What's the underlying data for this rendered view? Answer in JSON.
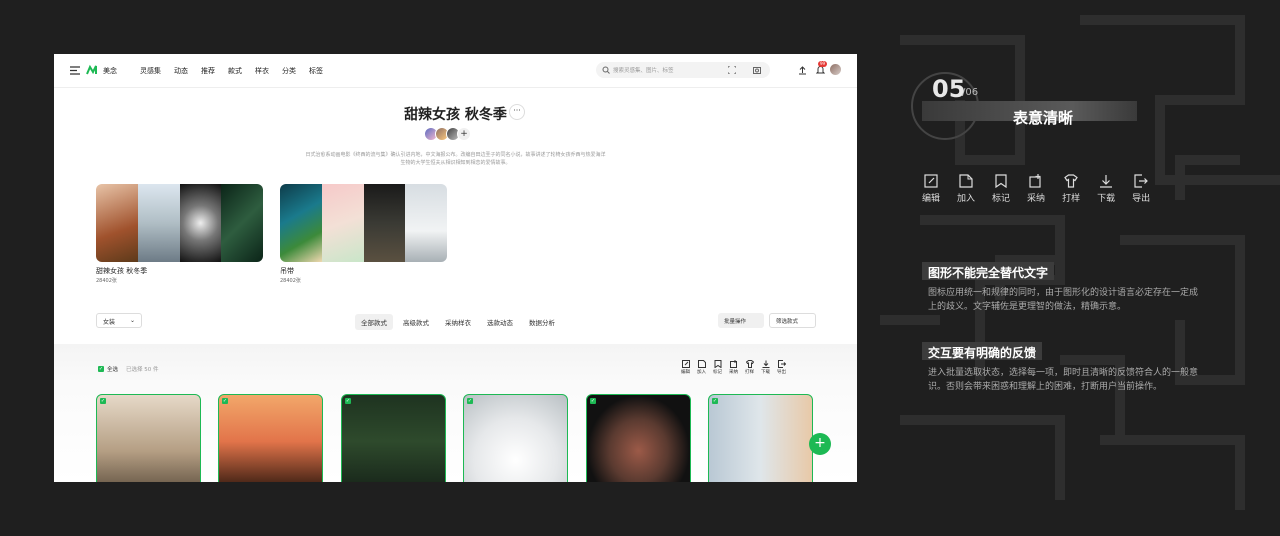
{
  "app": {
    "brand": "美念",
    "nav": [
      "灵感集",
      "动态",
      "推荐",
      "款式",
      "样衣",
      "分类",
      "标签"
    ],
    "search_placeholder": "搜索灵感集、图片、标签",
    "notification_count": "99"
  },
  "collection": {
    "title": "甜辣女孩 秋冬季",
    "more": "···",
    "add": "+",
    "description": "日式治愈系动画电影《终西的流与集》确认引进内地，中文海报公布。改编自田边圣子的同名小说，故事讲述了轮椅女孩乔西与热爱海洋生物的大学生恒夫从相识相知到相恋的爱情故事。"
  },
  "boards": [
    {
      "name": "甜辣女孩 秋冬季",
      "count": "28402张"
    },
    {
      "name": "吊带",
      "count": "28402张"
    }
  ],
  "filter": {
    "select": "女装",
    "chevron": "⌄"
  },
  "tabs": [
    "全部款式",
    "高级款式",
    "采纳样衣",
    "选款动态",
    "数据分析"
  ],
  "buttons": {
    "batch": "批量操作",
    "filter": "筛选款式"
  },
  "selection": {
    "check": "✓",
    "all": "全选",
    "count": "已选择 50 件"
  },
  "actions": [
    {
      "label": "编辑",
      "icon": "edit-icon"
    },
    {
      "label": "加入",
      "icon": "add-doc-icon"
    },
    {
      "label": "标记",
      "icon": "bookmark-icon"
    },
    {
      "label": "采纳",
      "icon": "adopt-icon"
    },
    {
      "label": "打样",
      "icon": "shirt-icon"
    },
    {
      "label": "下载",
      "icon": "download-icon"
    },
    {
      "label": "导出",
      "icon": "export-icon"
    }
  ],
  "fab": "+",
  "panel": {
    "page": "05",
    "total": "/06",
    "heading": "表意清晰",
    "sections": [
      {
        "title": "图形不能完全替代文字",
        "text": "图标应用统一和规律的同时，由于图形化的设计语言必定存在一定成上的歧义。文字辅佐是更理智的做法，精确示意。"
      },
      {
        "title": "交互要有明确的反馈",
        "text": "进入批量选取状态，选择每一项，即时且清晰的反馈符合人的一般意识。否则会带来困惑和理解上的困难，打断用户当前操作。"
      }
    ]
  }
}
